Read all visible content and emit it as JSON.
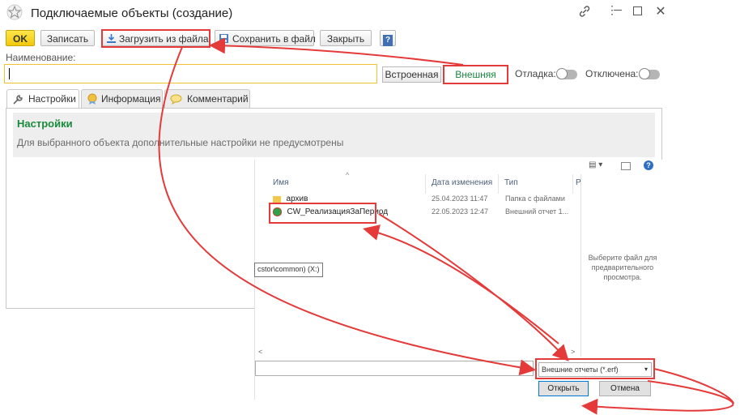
{
  "window": {
    "title": "Подключаемые объекты (создание)",
    "star_icon": "star-icon",
    "controls": [
      "link-icon",
      "more-icon",
      "minimize-icon",
      "maximize-icon",
      "close-icon"
    ]
  },
  "toolbar": {
    "ok_label": "OK",
    "save_label": "Записать",
    "load_label": "Загрузить из файла",
    "savefile_label": "Сохранить в файл",
    "close_label": "Закрыть",
    "help_label": "?"
  },
  "form": {
    "name_label": "Наименование:",
    "name_value": "",
    "builtin_label": "Встроенная",
    "external_label": "Внешняя",
    "debug_label": "Отладка:",
    "disabled_label": "Отключена:"
  },
  "tabs": [
    {
      "label": "Настройки",
      "icon": "wrench-icon"
    },
    {
      "label": "Информация",
      "icon": "award-icon"
    },
    {
      "label": "Комментарий",
      "icon": "comment-icon"
    }
  ],
  "settings": {
    "title": "Настройки",
    "text": "Для выбранного объекта дополнительные настройки не предусмотрены"
  },
  "file_dialog": {
    "columns": {
      "name": "Имя",
      "date": "Дата изменения",
      "type": "Тип",
      "size": "Р"
    },
    "files": [
      {
        "name": "архив",
        "date": "25.04.2023 11:47",
        "type": "Папка с файлами",
        "icon": "folder-icon"
      },
      {
        "name": "CW_РеализацияЗаПериод",
        "date": "22.05.2023 12:47",
        "type": "Внешний отчет 1...",
        "icon": "report-file-icon"
      }
    ],
    "tooltip": "cstor\\common) (X:)",
    "preview_text": "Выберите файл для предварительного просмотра.",
    "filter_value": "Внешние отчеты (*.erf)",
    "open_label": "Открыть",
    "cancel_label": "Отмена"
  },
  "colors": {
    "accent_green": "#1a8a3c",
    "annotation_red": "#e53a3a",
    "ok_yellow": "#f3c80b",
    "field_border": "#f2c235"
  }
}
